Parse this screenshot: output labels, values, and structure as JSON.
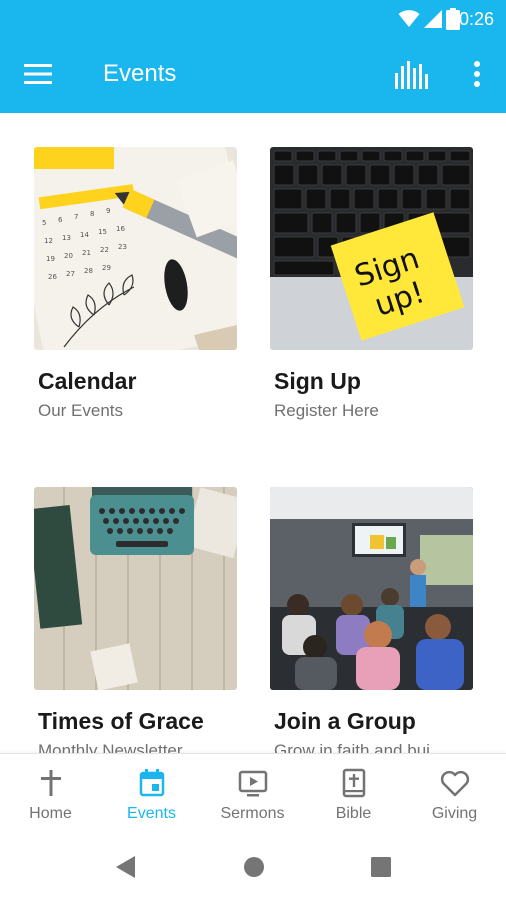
{
  "status_bar": {
    "time": "10:26"
  },
  "app_bar": {
    "title": "Events"
  },
  "cards": [
    {
      "title": "Calendar",
      "subtitle": "Our Events"
    },
    {
      "title": "Sign Up",
      "subtitle": "Register Here"
    },
    {
      "title": "Times of Grace",
      "subtitle": "Monthly Newsletter"
    },
    {
      "title": "Join a Group",
      "subtitle": "Grow in faith and bui..."
    }
  ],
  "signup_note_text": {
    "line1": "Sign",
    "line2": "up!"
  },
  "bottom_nav": [
    {
      "label": "Home",
      "icon": "cross-icon"
    },
    {
      "label": "Events",
      "icon": "calendar-icon",
      "active": true
    },
    {
      "label": "Sermons",
      "icon": "tv-play-icon"
    },
    {
      "label": "Bible",
      "icon": "bible-icon"
    },
    {
      "label": "Giving",
      "icon": "heart-icon"
    }
  ],
  "colors": {
    "accent": "#1ab6ee",
    "inactive": "#737373",
    "title_text": "#1a1a1a",
    "subtitle_text": "#707070"
  }
}
